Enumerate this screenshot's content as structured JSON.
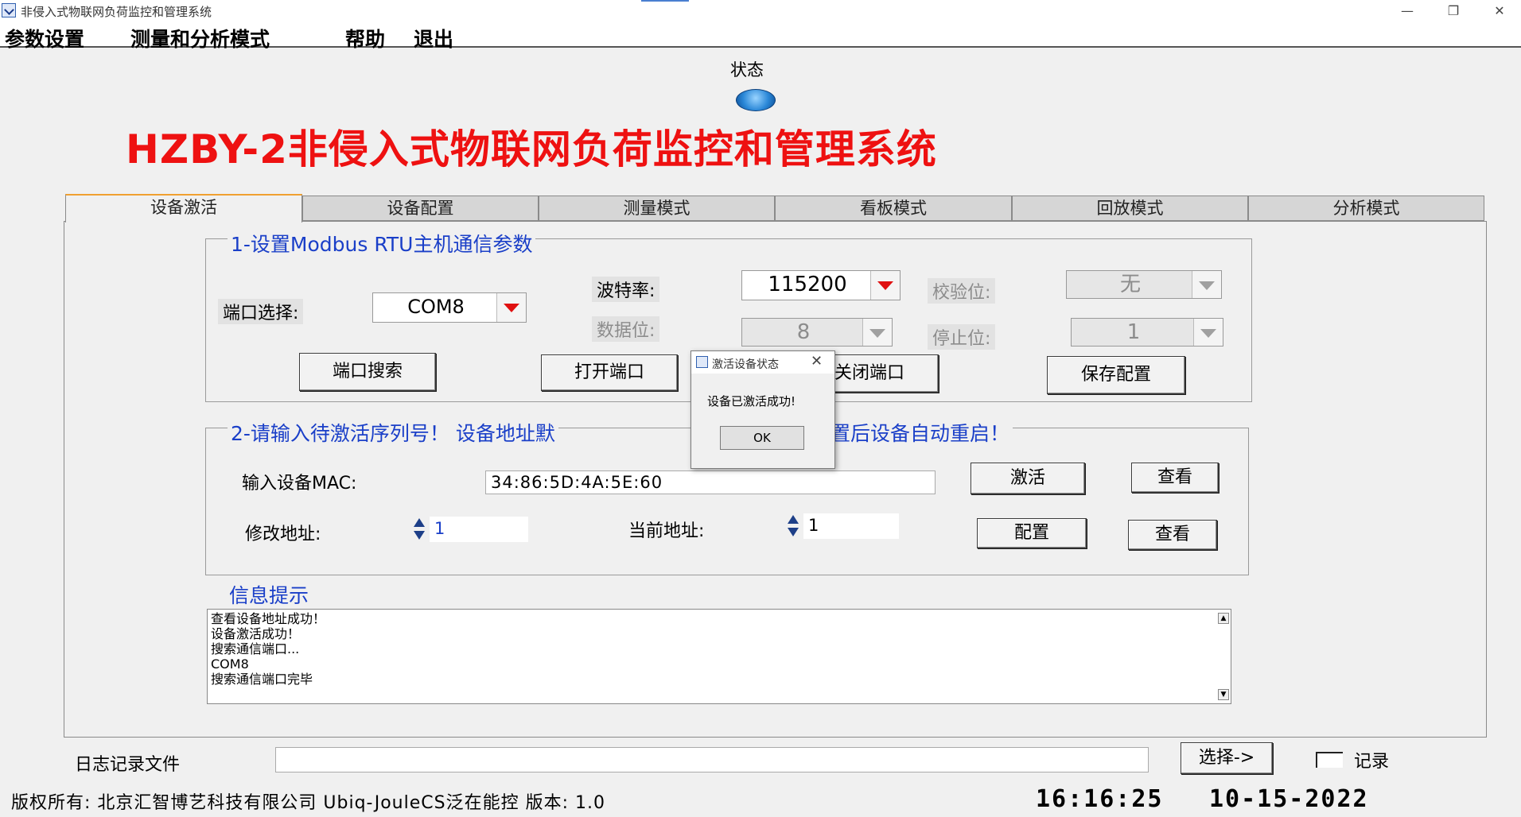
{
  "window": {
    "title": "非侵入式物联网负荷监控和管理系统",
    "minimize": "—",
    "restore": "❐",
    "close": "✕"
  },
  "menu": [
    "参数设置",
    "测量和分析模式",
    "帮助",
    "退出"
  ],
  "status": {
    "label": "状态"
  },
  "main_title": "HZBY-2非侵入式物联网负荷监控和管理系统",
  "tabs": [
    "设备激活",
    "设备配置",
    "测量模式",
    "看板模式",
    "回放模式",
    "分析模式"
  ],
  "group1": {
    "title": "1-设置Modbus RTU主机通信参数",
    "port_label": "端口选择:",
    "port_value": "COM8",
    "baud_label": "波特率:",
    "baud_value": "115200",
    "parity_label": "校验位:",
    "parity_value": "无",
    "databits_label": "数据位:",
    "databits_value": "8",
    "stopbits_label": "停止位:",
    "stopbits_value": "1",
    "btn_search": "端口搜索",
    "btn_open": "打开端口",
    "btn_close": "关闭端口",
    "btn_save": "保存配置"
  },
  "group2": {
    "title_left": "2-请输入待激活序列号！ 设备地址默",
    "title_right": "置后设备自动重启！",
    "mac_label": "输入设备MAC:",
    "mac_value": "34:86:5D:4A:5E:60",
    "btn_activate": "激活",
    "btn_view1": "查看",
    "modify_label": "修改地址:",
    "modify_value": "1",
    "current_label": "当前地址:",
    "current_value": "1",
    "btn_config": "配置",
    "btn_view2": "查看"
  },
  "info": {
    "title": "信息提示",
    "lines": [
      "查看设备地址成功！",
      "设备激活成功！",
      "搜索通信端口...",
      "COM8",
      "搜索通信端口完毕"
    ]
  },
  "logfile": {
    "label": "日志记录文件",
    "value": "",
    "btn_select": "选择->",
    "record_label": "记录"
  },
  "footer": {
    "copyright": "版权所有: 北京汇智博艺科技有限公司 Ubiq-JouleCS泛在能控 版本: 1.0",
    "time": "16:16:25",
    "date": "10-15-2022"
  },
  "dialog": {
    "title": "激活设备状态",
    "message": "设备已激活成功!",
    "ok": "OK",
    "close": "✕"
  }
}
